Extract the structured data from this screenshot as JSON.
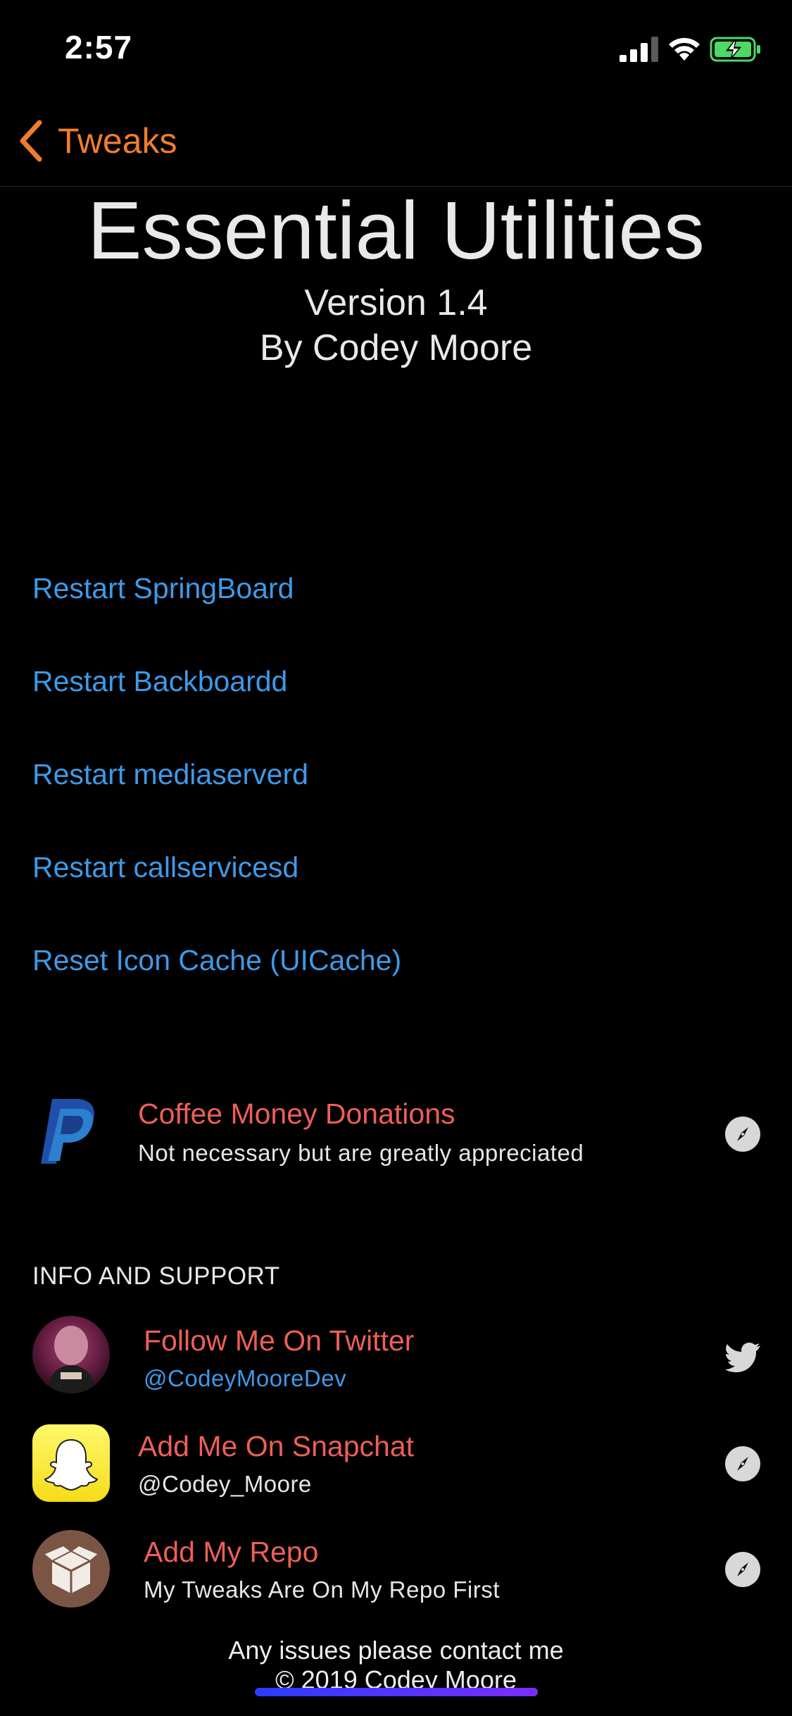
{
  "status_bar": {
    "time": "2:57"
  },
  "nav": {
    "back_label": "Tweaks"
  },
  "header": {
    "title": "Essential Utilities",
    "version": "Version 1.4",
    "author": "By Codey Moore"
  },
  "actions": [
    "Restart SpringBoard",
    "Restart Backboardd",
    "Restart mediaserverd",
    "Restart callservicesd",
    "Reset Icon Cache (UICache)"
  ],
  "donation": {
    "title": "Coffee Money Donations",
    "subtitle": "Not necessary but are greatly appreciated",
    "icon": "paypal-logo",
    "accessory": "compass-icon"
  },
  "info_section": {
    "header": "INFO AND SUPPORT",
    "items": [
      {
        "title": "Follow Me On Twitter",
        "subtitle": "@CodeyMooreDev",
        "icon": "avatar",
        "accessory": "twitter-bird-icon"
      },
      {
        "title": "Add Me On Snapchat",
        "subtitle": "@Codey_Moore",
        "icon": "snapchat-ghost",
        "accessory": "compass-icon"
      },
      {
        "title": "Add My Repo",
        "subtitle": "My Tweaks Are On My Repo First",
        "icon": "cydia-box",
        "accessory": "compass-icon"
      }
    ]
  },
  "footer": {
    "line1": "Any issues please contact me",
    "line2": "© 2019 Codey Moore"
  },
  "colors": {
    "accent_orange": "#f07d2c",
    "link_blue": "#3d9ae8",
    "row_title_red": "#ec5f58",
    "battery_green": "#4cd964"
  }
}
